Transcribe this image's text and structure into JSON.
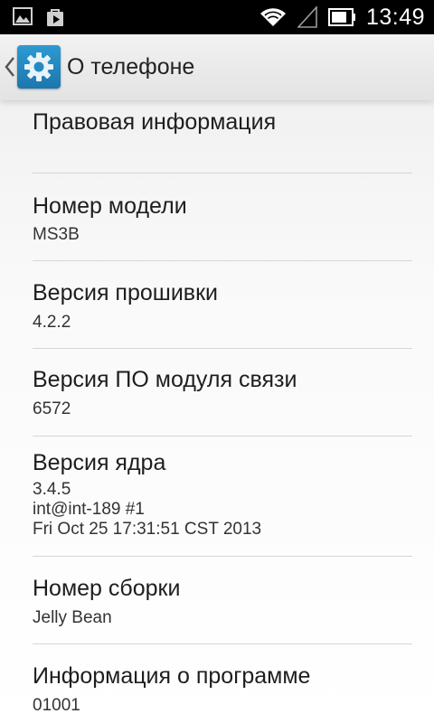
{
  "status_bar": {
    "time": "13:49",
    "icons": [
      "image-notification-icon",
      "play-store-notification-icon",
      "wifi-icon",
      "signal-icon",
      "battery-icon"
    ],
    "battery_level": 0.8
  },
  "action_bar": {
    "title": "О телефоне",
    "icon": "settings-gear-icon",
    "accent_color": "#2589c2"
  },
  "items": [
    {
      "title": "Правовая информация"
    },
    {
      "title": "Номер модели",
      "value": "MS3B"
    },
    {
      "title": "Версия прошивки",
      "value": "4.2.2"
    },
    {
      "title": "Версия ПО модуля связи",
      "value": "6572"
    },
    {
      "title": "Версия ядра",
      "value": "3.4.5\nint@int-189 #1\nFri Oct 25 17:31:51 CST 2013"
    },
    {
      "title": "Номер сборки",
      "value": "Jelly Bean"
    },
    {
      "title": "Информация о программе",
      "value": "01001"
    }
  ]
}
